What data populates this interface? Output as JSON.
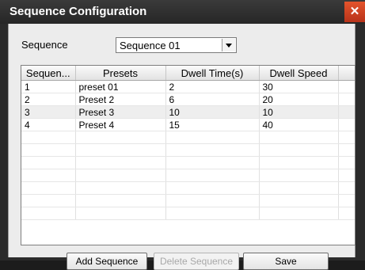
{
  "dialog": {
    "title": "Sequence Configuration",
    "close_glyph": "✕"
  },
  "sequence_select": {
    "label": "Sequence",
    "value": "Sequence 01"
  },
  "table": {
    "columns": [
      "Sequen...",
      "Presets",
      "Dwell Time(s)",
      "Dwell Speed"
    ],
    "rows": [
      [
        "1",
        "preset 01",
        "2",
        "30"
      ],
      [
        "2",
        "Preset 2",
        "6",
        "20"
      ],
      [
        "3",
        "Preset 3",
        "10",
        "10"
      ],
      [
        "4",
        "Preset 4",
        "15",
        "40"
      ]
    ],
    "selected_row": 2,
    "empty_rows": 7
  },
  "buttons": {
    "add": "Add Sequence",
    "delete": "Delete Sequence",
    "save": "Save"
  },
  "colors": {
    "titlebar": "#2b2b2b",
    "close": "#d6461f",
    "panel": "#ececec"
  },
  "icons": {
    "close": "close-icon",
    "dropdown": "chevron-down-icon"
  }
}
